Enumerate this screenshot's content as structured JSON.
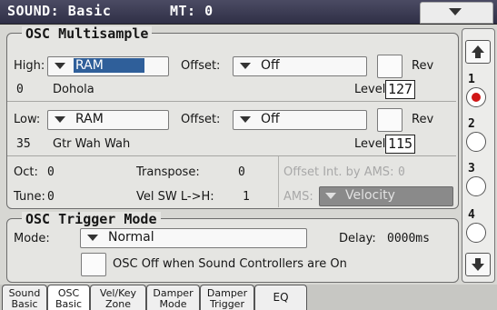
{
  "header": {
    "title": "SOUND: Basic",
    "mt": "MT: 0"
  },
  "osc_multisample": {
    "title": "OSC Multisample",
    "high": {
      "label": "High:",
      "source": "RAM",
      "offset_label": "Offset:",
      "offset_value": "Off",
      "rev_label": "Rev",
      "sample_number": "0",
      "sample_name": "Dohola",
      "level_label": "Level:",
      "level_value": "127"
    },
    "low": {
      "label": "Low:",
      "source": "RAM",
      "offset_label": "Offset:",
      "offset_value": "Off",
      "rev_label": "Rev",
      "sample_number": "35",
      "sample_name": "Gtr Wah Wah",
      "level_label": "Level:",
      "level_value": "115"
    },
    "oct_label": "Oct:",
    "oct_value": "0",
    "transpose_label": "Transpose:",
    "transpose_value": "0",
    "tune_label": "Tune:",
    "tune_value": "0",
    "vel_sw_label": "Vel SW L->H:",
    "vel_sw_value": "1",
    "offset_int_label": "Offset Int. by AMS:",
    "offset_int_value": "0",
    "ams_label": "AMS:",
    "ams_value": "Velocity"
  },
  "osc_trigger": {
    "title": "OSC Trigger Mode",
    "mode_label": "Mode:",
    "mode_value": "Normal",
    "delay_label": "Delay:",
    "delay_value": "0000ms",
    "osc_off_label": "OSC Off when Sound Controllers are On"
  },
  "side_rail": {
    "items": [
      "1",
      "2",
      "3",
      "4"
    ],
    "active_index": 0
  },
  "tabs": [
    {
      "line1": "Sound",
      "line2": "Basic"
    },
    {
      "line1": "OSC",
      "line2": "Basic"
    },
    {
      "line1": "Vel/Key",
      "line2": "Zone"
    },
    {
      "line1": "Damper",
      "line2": "Mode"
    },
    {
      "line1": "Damper",
      "line2": "Trigger"
    },
    {
      "line1": "EQ",
      "line2": ""
    }
  ],
  "colors": {
    "header_bg": "#3d3d56",
    "selected_field": "#2f5f9a",
    "radio_active": "#d01616"
  }
}
